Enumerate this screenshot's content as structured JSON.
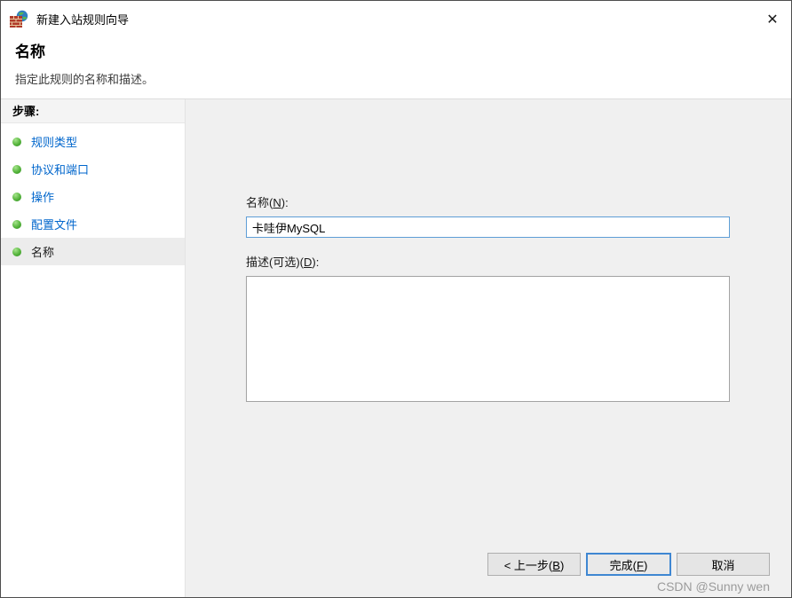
{
  "window": {
    "title": "新建入站规则向导",
    "close_glyph": "✕"
  },
  "header": {
    "title": "名称",
    "subtitle": "指定此规则的名称和描述。"
  },
  "sidebar": {
    "heading": "步骤:",
    "items": [
      {
        "label": "规则类型",
        "active": false
      },
      {
        "label": "协议和端口",
        "active": false
      },
      {
        "label": "操作",
        "active": false
      },
      {
        "label": "配置文件",
        "active": false
      },
      {
        "label": "名称",
        "active": true
      }
    ]
  },
  "form": {
    "name_label": {
      "pre": "名称(",
      "key": "N",
      "post": "):"
    },
    "name_value": "卡哇伊MySQL",
    "desc_label": {
      "pre": "描述(可选)(",
      "key": "D",
      "post": "):"
    },
    "desc_value": ""
  },
  "buttons": {
    "back": {
      "pre": "< 上一步(",
      "key": "B",
      "post": ")"
    },
    "finish": {
      "pre": "完成(",
      "key": "F",
      "post": ")"
    },
    "cancel": {
      "label": "取消"
    }
  },
  "watermark": "CSDN @Sunny wen",
  "colors": {
    "link_blue": "#0066cc",
    "focus_border_blue": "#3f87d2",
    "input_focus_blue": "#5e9ed6",
    "bullet_green": "#55b43c",
    "main_panel_gray": "#f0f0f0"
  }
}
